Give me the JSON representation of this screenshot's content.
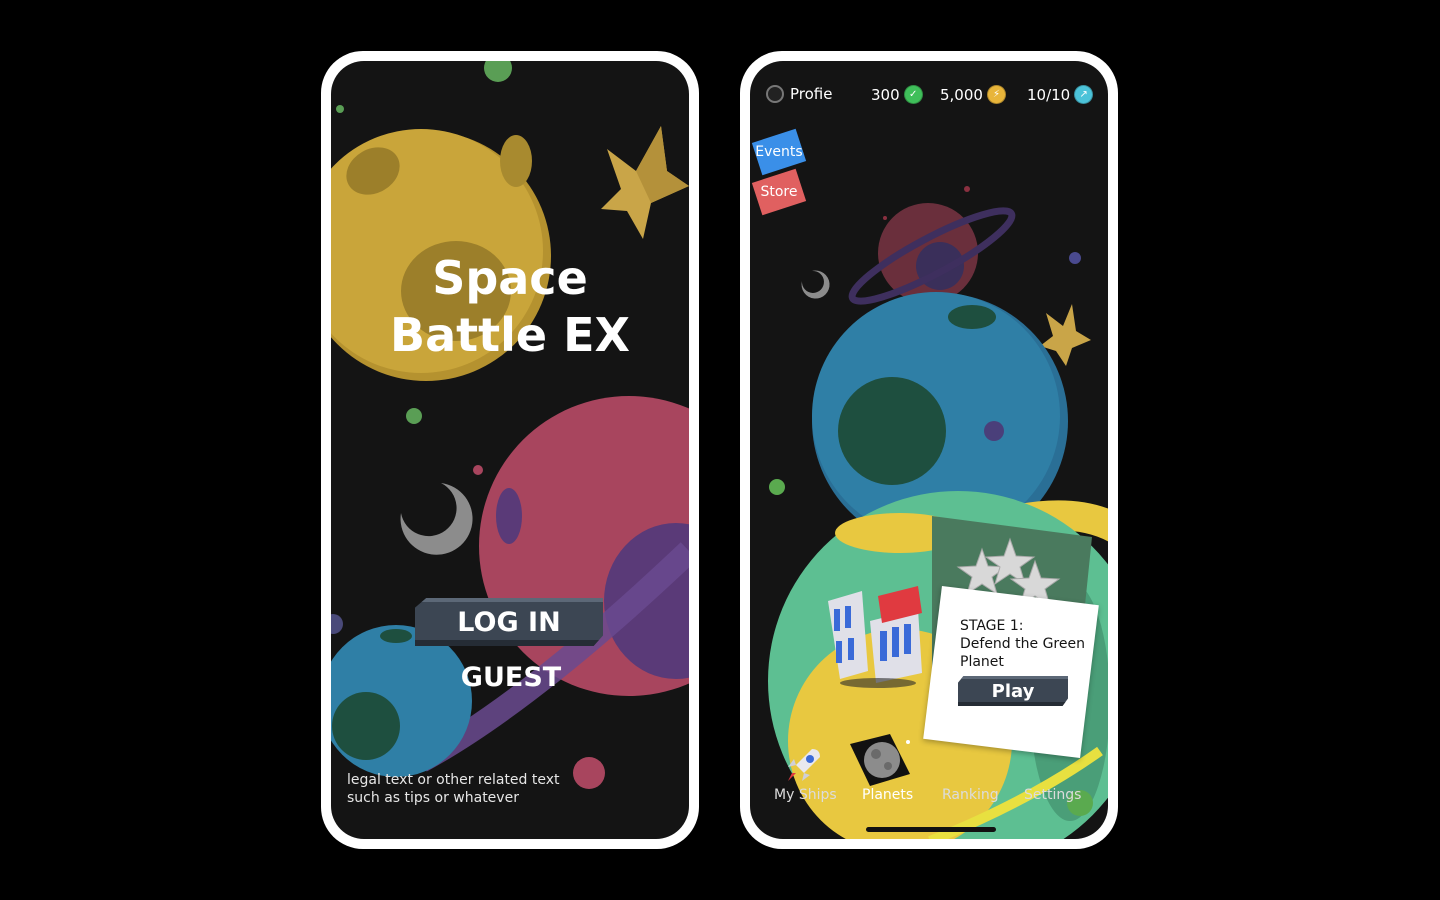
{
  "login_screen": {
    "title_line1": "Space",
    "title_line2": "Battle EX",
    "login_button": "LOG IN",
    "guest_button": "GUEST",
    "legal_line1": "legal text or other related text",
    "legal_line2": "such as tips or whatever"
  },
  "home_screen": {
    "profile_label": "Profie",
    "stats": [
      {
        "value": "300",
        "icon": "green-gem-icon",
        "color": "#3fbf5a"
      },
      {
        "value": "5,000",
        "icon": "gold-coin-icon",
        "color": "#e8b53a"
      },
      {
        "value": "10/10",
        "icon": "energy-icon",
        "color": "#4cc3d9"
      }
    ],
    "side_tabs": {
      "events": "Events",
      "store": "Store"
    },
    "stage": {
      "line1": "STAGE 1:",
      "line2": "Defend the Green",
      "line3": "Planet",
      "play_button": "Play"
    },
    "nav": {
      "my_ships": "My Ships",
      "planets": "Planets",
      "ranking": "Ranking",
      "settings": "Settings"
    }
  },
  "colors": {
    "background": "#141414",
    "button": "#3c4653",
    "yellow_planet": "#c9a53a",
    "pink_planet": "#a8455e",
    "blue_planet": "#2f7fa6",
    "green_planet": "#5dbf92"
  }
}
